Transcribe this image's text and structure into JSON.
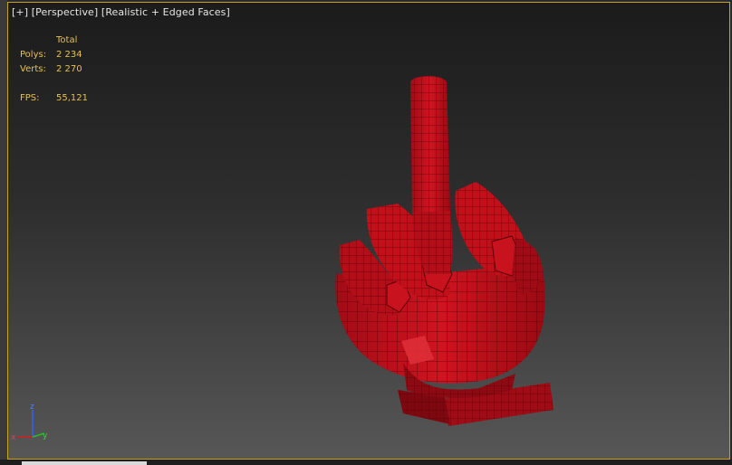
{
  "viewport": {
    "label_plus": "[+]",
    "label_view": "[Perspective]",
    "label_shading": "[Realistic + Edged Faces]"
  },
  "stats": {
    "header": "Total",
    "polys_label": "Polys:",
    "polys_value": "2 234",
    "verts_label": "Verts:",
    "verts_value": "2 270",
    "fps_label": "FPS:",
    "fps_value": "55,121"
  },
  "gizmo": {
    "z": "z",
    "x": "x",
    "y": "y"
  },
  "colors": {
    "viewport_border": "#c8a21e",
    "stats_text": "#e6c24a",
    "model_red": "#c8121e",
    "edge_dark": "#5a0008",
    "axis_x": "#d02020",
    "axis_y": "#20c020",
    "axis_z": "#3060ff"
  },
  "icons": {
    "model": "hand-mesh",
    "gizmo": "axis-tripod-icon"
  }
}
